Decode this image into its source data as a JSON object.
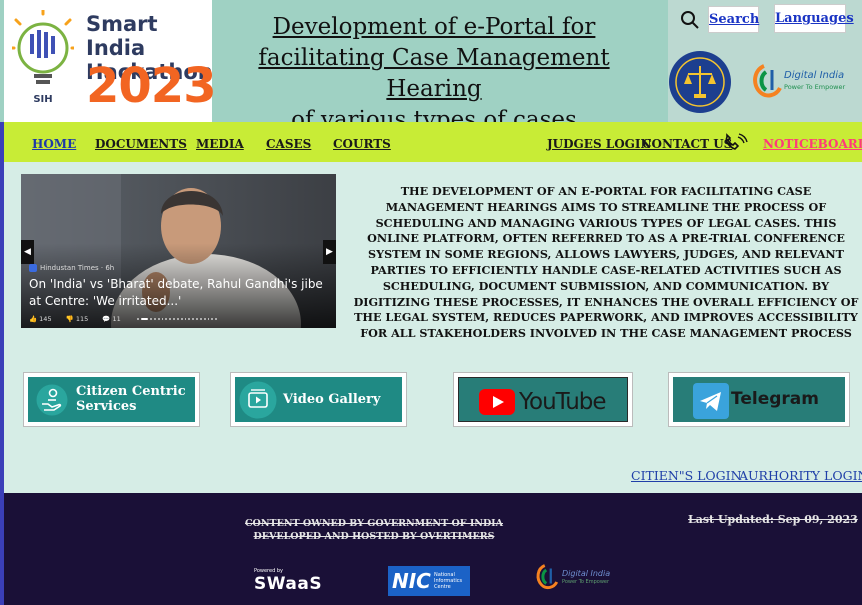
{
  "header": {
    "sih_title": "Smart India",
    "sih_subtitle": "Hackathon",
    "sih_year": "2023",
    "sih_badge": "SIH",
    "title_lines": [
      "Development of e-Portal for",
      "facilitating Case Management Hearing",
      "of various types of cases"
    ],
    "search_label": "Search",
    "languages_label": "Languages",
    "digital_india": "Digital India",
    "digital_india_tagline": "Power To Empower"
  },
  "nav": {
    "home": "HOME",
    "documents": "DOCUMENTS",
    "media": "MEDIA",
    "cases": "CASES",
    "courts": "COURTS",
    "judges_login": "JUDGES LOGIN",
    "contact_us": "CONTACT US",
    "noticeboard": "NOTICEBOARD"
  },
  "news": {
    "source": "Hindustan Times · 6h",
    "headline": "On 'India' vs 'Bharat' debate, Rahul Gandhi's jibe at Centre: 'We irritated...'",
    "likes": "145",
    "dislikes": "115",
    "comments": "11"
  },
  "description": "THE DEVELOPMENT OF AN E-PORTAL FOR FACILITATING CASE MANAGEMENT HEARINGS AIMS TO STREAMLINE THE PROCESS OF SCHEDULING AND MANAGING VARIOUS TYPES OF LEGAL CASES. THIS ONLINE PLATFORM, OFTEN REFERRED TO AS A PRE-TRIAL CONFERENCE SYSTEM IN SOME REGIONS, ALLOWS LAWYERS, JUDGES, AND RELEVANT PARTIES TO EFFICIENTLY HANDLE CASE-RELATED ACTIVITIES SUCH AS SCHEDULING, DOCUMENT SUBMISSION, AND COMMUNICATION. BY DIGITIZING THESE PROCESSES, IT ENHANCES THE OVERALL EFFICIENCY OF THE LEGAL SYSTEM, REDUCES PAPERWORK, AND IMPROVES ACCESSIBILITY FOR ALL STAKEHOLDERS INVOLVED IN THE CASE MANAGEMENT PROCESS",
  "cards": {
    "citizen_line1": "Citizen Centric",
    "citizen_line2": "Services",
    "video": "Video Gallery",
    "youtube": "YouTube",
    "telegram": "Telegram"
  },
  "logins": {
    "citizen": "CITIEN\"S LOGIN",
    "authority": "AURHORITY LOGIN"
  },
  "footer": {
    "owned": "CONTENT OWNED BY GOVERNMENT OF INDIA",
    "developed": "DEVELOPED AND HOSTED BY OVERTIMERS",
    "last_updated": "Last Updated: Sep 09, 2023",
    "swaas_powered": "Powered by",
    "swaas": "SWaaS",
    "nic": "NIC",
    "nic_sub1": "National",
    "nic_sub2": "Informatics",
    "nic_sub3": "Centre",
    "digital_india": "Digital India",
    "digital_india_tagline": "Power To Empower"
  },
  "colors": {
    "header_bg": "#9fd1c3",
    "nav_bg": "#c8ec36",
    "page_bg": "#d6ede6",
    "card_teal": "#1f8a84",
    "footer_bg": "#1a1037",
    "link_blue": "#1f3fa8",
    "notice_pink": "#ff3a7a",
    "sih_orange": "#f26522"
  },
  "icons": [
    "search-icon",
    "phone-icon",
    "citizen-hand-icon",
    "video-play-icon",
    "youtube-logo",
    "telegram-logo",
    "prev-arrow-icon",
    "next-arrow-icon"
  ]
}
